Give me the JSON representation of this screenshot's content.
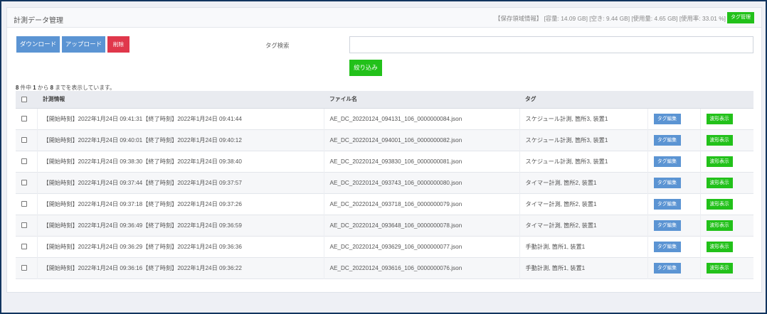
{
  "header": {
    "title": "計測データ管理",
    "storage_info": "【保存領域情報】 [容量: 14.09 GB] [空き: 9.44 GB] [使用量: 4.65 GB] [使用率: 33.01 %]",
    "tag_manage_label": "タグ管理"
  },
  "toolbar": {
    "download_label": "ダウンロード",
    "upload_label": "アップロード",
    "delete_label": "削除"
  },
  "search": {
    "label": "タグ検索",
    "value": "",
    "filter_label": "絞り込み"
  },
  "results": {
    "prefix": "",
    "total": "8",
    "mid1": " 件中 ",
    "from": "1",
    "mid2": " から ",
    "to": "8",
    "suffix": " までを表示しています。"
  },
  "table": {
    "columns": [
      "",
      "計測情報",
      "ファイル名",
      "タグ",
      "",
      ""
    ],
    "tag_edit_label": "タグ編集",
    "waveform_label": "波形表示",
    "rows": [
      {
        "info": "【開始時刻】2022年1月24日 09:41:31【終了時刻】2022年1月24日 09:41:44",
        "file": "AE_DC_20220124_094131_106_0000000084.json",
        "tag": "スケジュール計測, 箇所3, 装置1"
      },
      {
        "info": "【開始時刻】2022年1月24日 09:40:01【終了時刻】2022年1月24日 09:40:12",
        "file": "AE_DC_20220124_094001_106_0000000082.json",
        "tag": "スケジュール計測, 箇所3, 装置1"
      },
      {
        "info": "【開始時刻】2022年1月24日 09:38:30【終了時刻】2022年1月24日 09:38:40",
        "file": "AE_DC_20220124_093830_106_0000000081.json",
        "tag": "スケジュール計測, 箇所3, 装置1"
      },
      {
        "info": "【開始時刻】2022年1月24日 09:37:44【終了時刻】2022年1月24日 09:37:57",
        "file": "AE_DC_20220124_093743_106_0000000080.json",
        "tag": "タイマー計測, 箇所2, 装置1"
      },
      {
        "info": "【開始時刻】2022年1月24日 09:37:18【終了時刻】2022年1月24日 09:37:26",
        "file": "AE_DC_20220124_093718_106_0000000079.json",
        "tag": "タイマー計測, 箇所2, 装置1"
      },
      {
        "info": "【開始時刻】2022年1月24日 09:36:49【終了時刻】2022年1月24日 09:36:59",
        "file": "AE_DC_20220124_093648_106_0000000078.json",
        "tag": "タイマー計測, 箇所2, 装置1"
      },
      {
        "info": "【開始時刻】2022年1月24日 09:36:29【終了時刻】2022年1月24日 09:36:36",
        "file": "AE_DC_20220124_093629_106_0000000077.json",
        "tag": "手動計測, 箇所1, 装置1"
      },
      {
        "info": "【開始時刻】2022年1月24日 09:36:16【終了時刻】2022年1月24日 09:36:22",
        "file": "AE_DC_20220124_093616_106_0000000076.json",
        "tag": "手動計測, 箇所1, 装置1"
      }
    ]
  },
  "colors": {
    "primary": "#5b94d3",
    "danger": "#e0374b",
    "success": "#22c11a",
    "frame": "#12355f"
  }
}
